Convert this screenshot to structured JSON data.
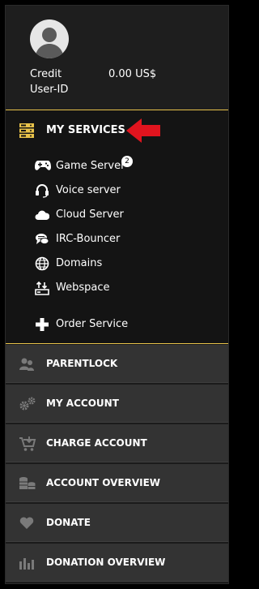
{
  "profile": {
    "credit_label": "Credit",
    "balance": "0.00 US$",
    "userid_label": "User-ID"
  },
  "services": {
    "title": "MY SERVICES",
    "items": [
      {
        "label": "Game Server",
        "icon": "gamepad-icon",
        "badge": "2"
      },
      {
        "label": "Voice server",
        "icon": "headset-icon"
      },
      {
        "label": "Cloud Server",
        "icon": "cloud-icon"
      },
      {
        "label": "IRC-Bouncer",
        "icon": "chat-icon"
      },
      {
        "label": "Domains",
        "icon": "globe-icon"
      },
      {
        "label": "Webspace",
        "icon": "upload-icon"
      }
    ],
    "order": {
      "label": "Order Service",
      "icon": "plus-icon"
    }
  },
  "menu": {
    "items": [
      {
        "label": "PARENTLOCK",
        "icon": "users-icon"
      },
      {
        "label": "MY ACCOUNT",
        "icon": "gears-icon"
      },
      {
        "label": "CHARGE ACCOUNT",
        "icon": "cart-icon"
      },
      {
        "label": "ACCOUNT OVERVIEW",
        "icon": "coins-icon"
      },
      {
        "label": "DONATE",
        "icon": "heart-icon"
      },
      {
        "label": "DONATION OVERVIEW",
        "icon": "bar-chart-icon"
      }
    ]
  },
  "colors": {
    "accent": "#e8c24a",
    "arrow": "#e0141e",
    "panel": "#1c1c1c",
    "menu_bg": "#333333"
  }
}
